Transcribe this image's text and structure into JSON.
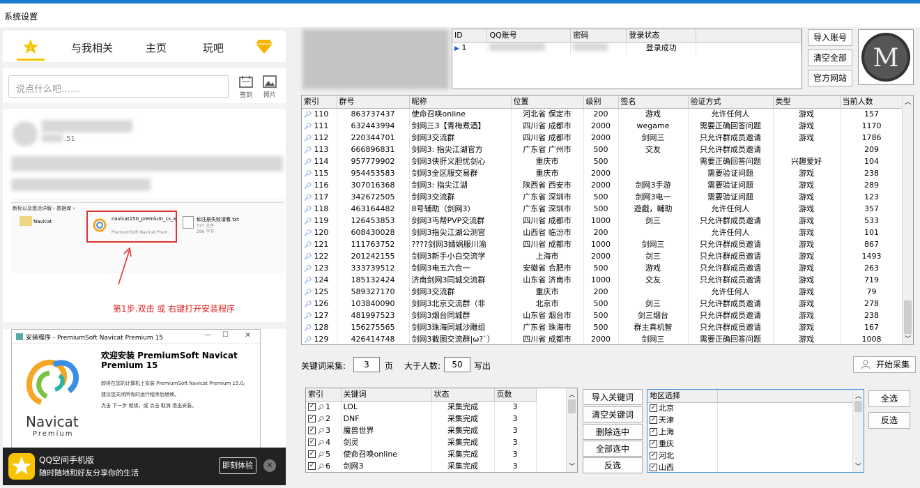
{
  "window": {
    "title": "系统设置"
  },
  "phone": {
    "tabs": [
      "与我相关",
      "主页",
      "玩吧"
    ],
    "input_placeholder": "说点什么吧……",
    "sign_label": "签到",
    "photo_label": "照片",
    "post_snippet": ".51",
    "step_text": "第1步.双击 或 右键打开安装程序",
    "explorer": {
      "breadcrumb": "新标以及激活详解 › 数据库 ›",
      "folder": "Navicat",
      "file_name": "navicat150_premium_cs_x64.exe",
      "file_desc": "PremiumSoft Navicat Prem...",
      "txt_name": "如注册失败请看.txt",
      "txt_type": "TXT 文件",
      "txt_size": "286 字节"
    },
    "installer": {
      "title": "安装程序 - PremiumSoft Navicat Premium 15",
      "heading": "欢迎安装 PremiumSoft Navicat Premium 15",
      "line1": "即将在您的计算机上安装 PremiumSoft Navicat Premium 15.0。",
      "line2": "建议您关闭所有的运行程序后继续。",
      "line3": "点击 下一步 继续，或 点击 取消 退出安装。",
      "logo_name": "Navicat",
      "logo_sub": "Premium"
    },
    "app_banner": {
      "title": "QQ空间手机版",
      "subtitle": "随时随地和好友分享你的生活",
      "button": "即刻体验"
    }
  },
  "accounts": {
    "headers": [
      "ID",
      "QQ账号",
      "密码",
      "登录状态"
    ],
    "rows": [
      {
        "id": "1",
        "status": "登录成功"
      }
    ]
  },
  "buttons": {
    "import_account": "导入账号",
    "clear_all": "清空全部",
    "official_site": "官方网站",
    "start_collect": "开始采集",
    "import_kw": "导入关键词",
    "clear_kw": "清空关键词",
    "delete_sel": "删除选中",
    "select_all": "全部选中",
    "invert": "反选",
    "all": "全选",
    "invert2": "反选"
  },
  "groups": {
    "headers": [
      "索引",
      "群号",
      "昵称",
      "位置",
      "级别",
      "签名",
      "验证方式",
      "类型",
      "当前人数"
    ],
    "rows": [
      [
        "110",
        "863737437",
        "使命召唤online",
        "河北省 保定市",
        "200",
        "游戏",
        "允许任何人",
        "游戏",
        "157"
      ],
      [
        "111",
        "632443994",
        "剑网三3【青梅煮酒】",
        "四川省 成都市",
        "2000",
        "wegame",
        "需要正确回答问题",
        "游戏",
        "1170"
      ],
      [
        "112",
        "220344701",
        "剑网3交流群",
        "四川省 成都市",
        "2000",
        "剑网三",
        "只允许群成员邀请",
        "游戏",
        "1786"
      ],
      [
        "113",
        "666896831",
        "剑网3: 指尖江湖官方",
        "广东省 广州市",
        "500",
        "交友",
        "只允许群成员邀请",
        "",
        "209"
      ],
      [
        "114",
        "957779902",
        "剑网3侠肝义胆忧剑心",
        "重庆市",
        "500",
        "",
        "需要正确回答问题",
        "兴趣爱好",
        "104"
      ],
      [
        "115",
        "954453583",
        "剑网3全区服交易群",
        "重庆市",
        "2000",
        "",
        "需要验证问题",
        "游戏",
        "238"
      ],
      [
        "116",
        "307016368",
        "剑网3: 指尖江湖",
        "陕西省 西安市",
        "2000",
        "剑网3手游",
        "需要验证问题",
        "游戏",
        "289"
      ],
      [
        "117",
        "342672505",
        "剑网3交流群",
        "广东省 深圳市",
        "500",
        "剑网3电一",
        "需要验证问题",
        "游戏",
        "123"
      ],
      [
        "118",
        "463164482",
        "8号辅助（剑网3）",
        "广东省 深圳市",
        "500",
        "遊戲，輔助",
        "允许任何人",
        "游戏",
        "357"
      ],
      [
        "119",
        "126453853",
        "剑网3丐帮PVP交流群",
        "四川省 成都市",
        "1000",
        "剑三",
        "只允许群成员邀请",
        "游戏",
        "533"
      ],
      [
        "120",
        "608430028",
        "剑网3指尖江湖公测官",
        "山西省 临汾市",
        "200",
        "",
        "允许任何人",
        "游戏",
        "101"
      ],
      [
        "121",
        "111763752",
        "????剑网3婧娲服川渝",
        "四川省 成都市",
        "1000",
        "剑网三",
        "只允许群成员邀请",
        "游戏",
        "867"
      ],
      [
        "122",
        "201242155",
        "剑网3新手小白交流学",
        "上海市",
        "2000",
        "剑三",
        "只允许群成员邀请",
        "游戏",
        "1493"
      ],
      [
        "123",
        "333739512",
        "剑网3电五六合一",
        "安徽省 合肥市",
        "500",
        "游戏",
        "只允许群成员邀请",
        "游戏",
        "263"
      ],
      [
        "124",
        "185132424",
        "济南剑网3同城交流群",
        "山东省 济南市",
        "1000",
        "交友",
        "只允许群成员邀请",
        "游戏",
        "719"
      ],
      [
        "125",
        "589327170",
        "剑网3交流群",
        "重庆市",
        "200",
        "",
        "允许任何人",
        "游戏",
        "79"
      ],
      [
        "126",
        "103840090",
        "剑网3北京交流群（非",
        "北京市",
        "500",
        "剑三",
        "只允许群成员邀请",
        "游戏",
        "278"
      ],
      [
        "127",
        "481997523",
        "剑网3烟台同城群",
        "山东省 烟台市",
        "500",
        "剑三烟台",
        "只允许群成员邀请",
        "游戏",
        "238"
      ],
      [
        "128",
        "156275565",
        "剑网3珠海同城沙雕组",
        "广东省 珠海市",
        "500",
        "群主真机智",
        "只允许群成员邀请",
        "游戏",
        "167"
      ],
      [
        "129",
        "426414748",
        "剑网3截图交流群|ω?`）",
        "四川省 成都市",
        "2000",
        "剑网三",
        "需要正确回答问题",
        "游戏",
        "1008"
      ]
    ]
  },
  "collect": {
    "kw_label": "关键词采集:",
    "pages": "3",
    "page_unit": "页",
    "gt_label": "大于人数:",
    "min_people": "50",
    "write_label": "写出"
  },
  "keywords": {
    "headers": [
      "索引",
      "关键词",
      "状态",
      "页数"
    ],
    "rows": [
      [
        "1",
        "LOL",
        "采集完成",
        "3"
      ],
      [
        "2",
        "DNF",
        "采集完成",
        "3"
      ],
      [
        "3",
        "魔兽世界",
        "采集完成",
        "3"
      ],
      [
        "4",
        "剑灵",
        "采集完成",
        "3"
      ],
      [
        "5",
        "使命召唤online",
        "采集完成",
        "3"
      ],
      [
        "6",
        "剑网3",
        "采集完成",
        "3"
      ]
    ]
  },
  "regions": {
    "header": "地区选择",
    "items": [
      "北京",
      "天津",
      "上海",
      "重庆",
      "河北",
      "山西"
    ]
  }
}
